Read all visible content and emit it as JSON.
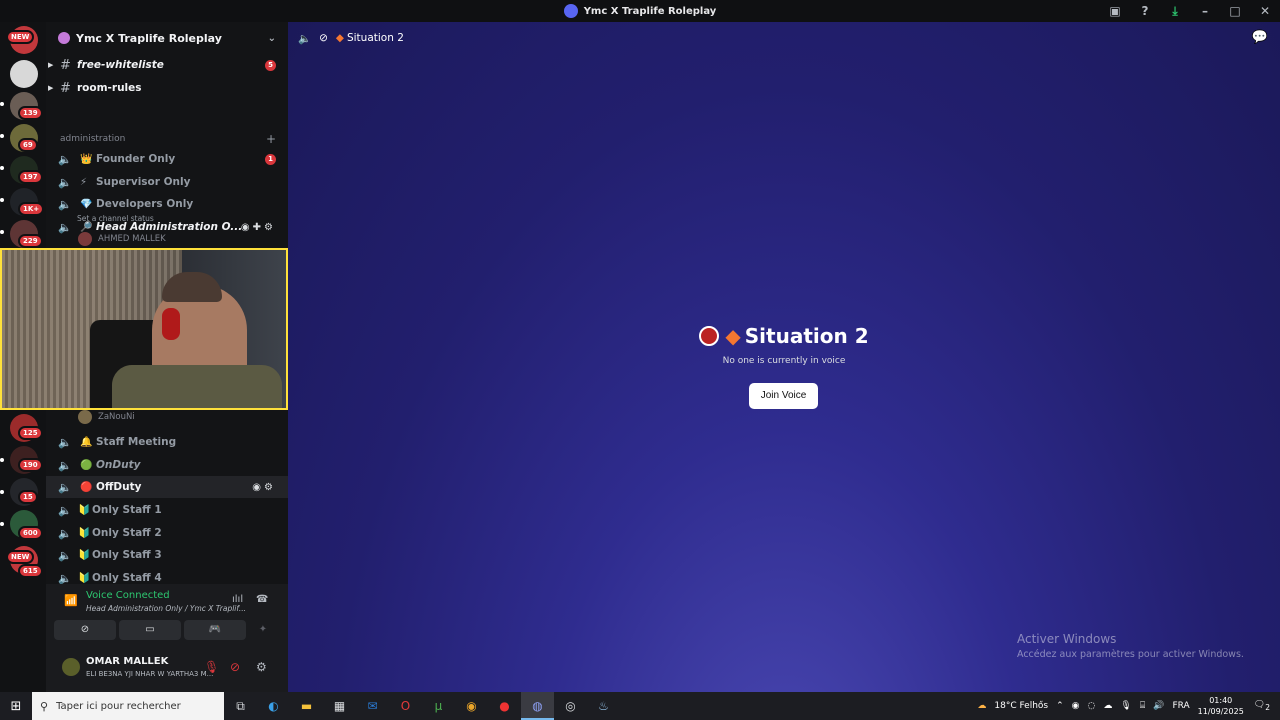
{
  "window": {
    "title": "Ymc X Traplife Roleplay"
  },
  "servers": {
    "badges": [
      "NEW",
      "139",
      "69",
      "197",
      "1K+",
      "229",
      "125",
      "190",
      "15",
      "600",
      "NEW",
      "615"
    ]
  },
  "guild": {
    "name": "Ymc X Traplife Roleplay"
  },
  "text_channels": [
    {
      "name": "free-whiteliste",
      "count": "5"
    },
    {
      "name": "room-rules"
    }
  ],
  "category": {
    "name": "administration"
  },
  "voice_channels": [
    {
      "emoji": "👑",
      "name": "Founder Only",
      "count": "1"
    },
    {
      "emoji": "⚡",
      "name": "Supervisor Only"
    },
    {
      "emoji": "💎",
      "name": "Developers Only"
    },
    {
      "emoji": "🔎",
      "name": "Head Administration O..."
    },
    {
      "emoji": "🔔",
      "name": "Staff Meeting"
    },
    {
      "emoji": "🟢",
      "name": "OnDuty"
    },
    {
      "emoji": "🔴",
      "name": "OffDuty"
    },
    {
      "emoji": "🔰",
      "name": "Only Staff 1"
    },
    {
      "emoji": "🔰",
      "name": "Only Staff 2"
    },
    {
      "emoji": "🔰",
      "name": "Only Staff 3"
    },
    {
      "emoji": "🔰",
      "name": "Only Staff 4"
    }
  ],
  "channel_status_hint": "Set a channel status",
  "members": [
    "AHMED MALLEK",
    "ZaNouNi"
  ],
  "voice": {
    "status": "Voice Connected",
    "channel": "Head Administration Only / Ymc X Traplif..."
  },
  "user": {
    "name": "OMAR MALLEK",
    "status": "ELI BE3NA YJI NHAR W YARTHA3 M..."
  },
  "main": {
    "channel_name": "Situation 2",
    "empty_text": "No one is currently in voice",
    "join_label": "Join Voice"
  },
  "watermark": {
    "title": "Activer Windows",
    "subtitle": "Accédez aux paramètres pour activer Windows."
  },
  "taskbar": {
    "search_placeholder": "Taper ici pour rechercher",
    "weather": "18°C Felhős",
    "lang": "FRA",
    "time": "01:40",
    "date": "11/09/2025",
    "notifications": "2"
  }
}
